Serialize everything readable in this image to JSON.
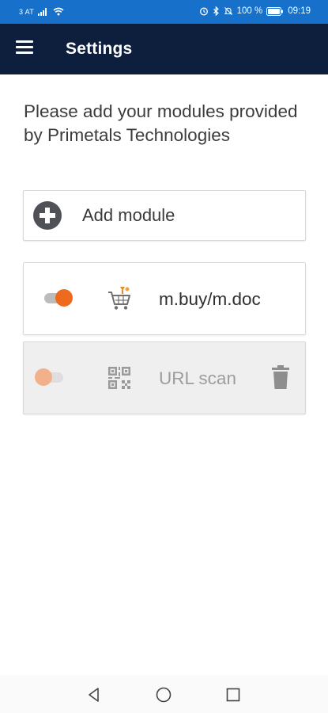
{
  "status_bar": {
    "carrier": "3 AT",
    "battery_percent": "100 %",
    "time": "09:19",
    "colors": {
      "background": "#1770c9"
    },
    "icons": [
      "signal-icon",
      "wifi-icon",
      "alarm-icon",
      "bluetooth-icon",
      "mute-icon",
      "battery-icon"
    ]
  },
  "app_bar": {
    "title": "Settings",
    "menu_icon": "hamburger-menu-icon",
    "colors": {
      "background": "#0d1f3c"
    }
  },
  "intro": {
    "text": "Please add your modules provided by Primetals Technologies"
  },
  "add_module": {
    "label": "Add module",
    "icon": "add-circle-icon"
  },
  "modules": [
    {
      "label": "m.buy/m.doc",
      "enabled": true,
      "icon": "shopping-cart-icon"
    },
    {
      "label": "URL scan",
      "enabled": false,
      "icon": "qr-code-icon",
      "delete_icon": "trash-icon"
    }
  ],
  "nav_bar": {
    "icons": [
      "back-triangle-icon",
      "home-circle-icon",
      "recents-square-icon"
    ]
  },
  "colors": {
    "accent": "#ee6a1e",
    "accent_disabled": "#f2b08b"
  }
}
